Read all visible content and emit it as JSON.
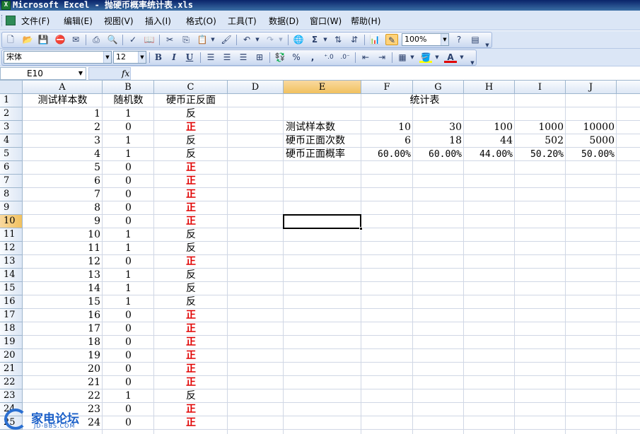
{
  "title_bar": {
    "text": "Microsoft Excel - 抛硬币概率统计表.xls",
    "app_icon_glyph": "X"
  },
  "menu": [
    "文件(F)",
    "编辑(E)",
    "视图(V)",
    "插入(I)",
    "格式(O)",
    "工具(T)",
    "数据(D)",
    "窗口(W)",
    "帮助(H)"
  ],
  "toolbar": {
    "zoom_value": "100%",
    "font_name": "宋体",
    "font_size": "12",
    "bold_label": "B",
    "italic_label": "I",
    "underline_label": "U",
    "percent_label": "%",
    "comma_label": ",",
    "font_color_label": "A",
    "sigma_label": "Σ"
  },
  "formula_bar": {
    "name_box": "E10",
    "fx_label": "fx",
    "content": ""
  },
  "colors": {
    "red_text": "#e00000",
    "selection_header": "#f1c15f",
    "grid_line": "#d0d7e5"
  },
  "columns": [
    "A",
    "B",
    "C",
    "D",
    "E",
    "F",
    "G",
    "H",
    "I",
    "J"
  ],
  "rows": [
    "1",
    "2",
    "3",
    "4",
    "5",
    "6",
    "7",
    "8",
    "9",
    "10",
    "11",
    "12",
    "13",
    "14",
    "15",
    "16",
    "17",
    "18",
    "19",
    "20",
    "21",
    "22",
    "23",
    "24",
    "25"
  ],
  "selected": {
    "column": "E",
    "row": "10"
  },
  "sheet": {
    "headers": {
      "A1": "测试样本数",
      "B1": "随机数",
      "C1": "硬币正反面"
    },
    "data_rows": [
      {
        "a": "1",
        "b": "1",
        "c": "反"
      },
      {
        "a": "2",
        "b": "0",
        "c": "正"
      },
      {
        "a": "3",
        "b": "1",
        "c": "反"
      },
      {
        "a": "4",
        "b": "1",
        "c": "反"
      },
      {
        "a": "5",
        "b": "0",
        "c": "正"
      },
      {
        "a": "6",
        "b": "0",
        "c": "正"
      },
      {
        "a": "7",
        "b": "0",
        "c": "正"
      },
      {
        "a": "8",
        "b": "0",
        "c": "正"
      },
      {
        "a": "9",
        "b": "0",
        "c": "正"
      },
      {
        "a": "10",
        "b": "1",
        "c": "反"
      },
      {
        "a": "11",
        "b": "1",
        "c": "反"
      },
      {
        "a": "12",
        "b": "0",
        "c": "正"
      },
      {
        "a": "13",
        "b": "1",
        "c": "反"
      },
      {
        "a": "14",
        "b": "1",
        "c": "反"
      },
      {
        "a": "15",
        "b": "1",
        "c": "反"
      },
      {
        "a": "16",
        "b": "0",
        "c": "正"
      },
      {
        "a": "17",
        "b": "0",
        "c": "正"
      },
      {
        "a": "18",
        "b": "0",
        "c": "正"
      },
      {
        "a": "19",
        "b": "0",
        "c": "正"
      },
      {
        "a": "20",
        "b": "0",
        "c": "正"
      },
      {
        "a": "21",
        "b": "0",
        "c": "正"
      },
      {
        "a": "22",
        "b": "1",
        "c": "反"
      },
      {
        "a": "23",
        "b": "0",
        "c": "正"
      },
      {
        "a": "24",
        "b": "0",
        "c": "正"
      }
    ],
    "stats": {
      "title": "统计表",
      "rows": [
        {
          "label": "测试样本数",
          "values": [
            "10",
            "30",
            "100",
            "1000",
            "10000"
          ]
        },
        {
          "label": "硬币正面次数",
          "values": [
            "6",
            "18",
            "44",
            "502",
            "5000"
          ]
        },
        {
          "label": "硬币正面概率",
          "values": [
            "60.00%",
            "60.00%",
            "44.00%",
            "50.20%",
            "50.00%"
          ]
        }
      ]
    }
  },
  "watermark": {
    "text": "家电论坛",
    "sub": "JD-BBS.COM"
  }
}
